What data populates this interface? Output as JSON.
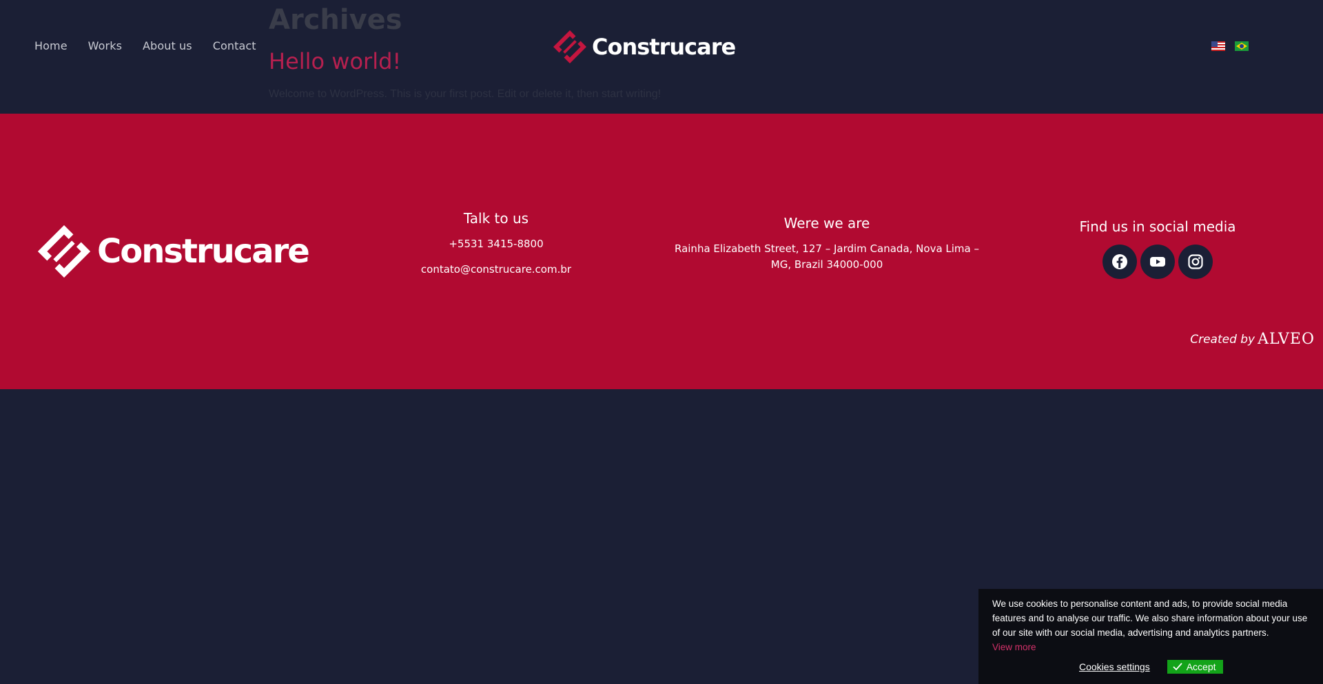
{
  "header": {
    "nav": [
      "Home",
      "Works",
      "About us",
      "Contact"
    ],
    "brand": "Construcare",
    "languages": [
      "English",
      "Português"
    ]
  },
  "archive": {
    "title": "Archives",
    "post_title": "Hello world!",
    "post_excerpt": "Welcome to WordPress. This is your first post. Edit or delete it, then start writing!"
  },
  "footer": {
    "brand": "Construcare",
    "talk": {
      "heading": "Talk to us",
      "phone": "+5531 3415-8800",
      "email": "contato@construcare.com.br"
    },
    "where": {
      "heading": "Were we are",
      "address": "Rainha Elizabeth Street, 127 – Jardim Canada, Nova Lima – MG, Brazil 34000-000"
    },
    "social": {
      "heading": "Find us in social media",
      "icons": [
        "facebook-icon",
        "youtube-icon",
        "instagram-icon"
      ]
    },
    "credit": {
      "label": "Created by",
      "brand": "ALVEO"
    }
  },
  "cookie": {
    "text": "We use cookies to personalise content and ads, to provide social media features and to analyse our traffic. We also share information about your use of our site with our social media, advertising and analytics partners.",
    "more": "View more",
    "settings": "Cookies settings",
    "accept": "Accept"
  },
  "colors": {
    "background": "#1b1f35",
    "footer": "#b10a31",
    "accent": "#b6204f",
    "accept": "#13a319"
  }
}
